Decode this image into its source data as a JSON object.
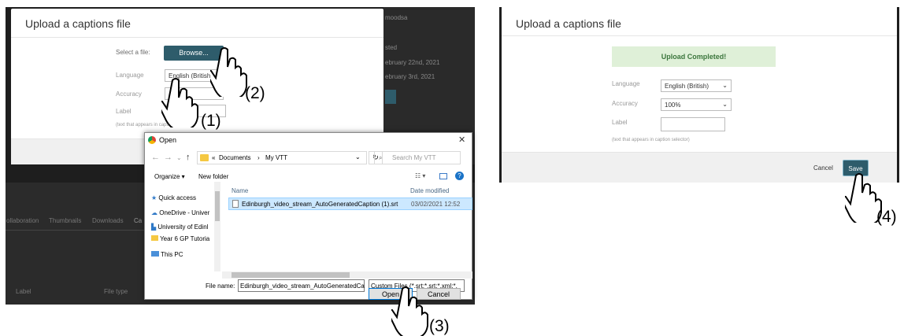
{
  "left_dialog": {
    "title": "Upload a captions file",
    "select_file_label": "Select a file:",
    "browse_button": "Browse...",
    "language_label": "Language",
    "language_value": "English (British)",
    "accuracy_label": "Accuracy",
    "label_label": "Label",
    "label_hint": "(text that appears in caption selector)"
  },
  "background_page": {
    "side_text_1": "moodsa",
    "side_text_2": "sted",
    "side_text_3": "ebruary 22nd, 2021",
    "side_text_4": "ebruary 3rd, 2021",
    "tabs": [
      "ollaboration",
      "Thumbnails",
      "Downloads",
      "Ca"
    ],
    "col_label": "Label",
    "col_filetype": "File type"
  },
  "open_dialog": {
    "title": "Open",
    "breadcrumb_prefix": "«",
    "breadcrumb_1": "Documents",
    "breadcrumb_sep": "›",
    "breadcrumb_2": "My VTT",
    "search_placeholder": "Search My VTT",
    "organize": "Organize ▾",
    "new_folder": "New folder",
    "nav_items": [
      "Quick access",
      "OneDrive - Univer",
      "University of Edinl",
      "Year 6 GP Tutoria",
      "This PC"
    ],
    "col_name": "Name",
    "col_date": "Date modified",
    "file_name": "Edinburgh_video_stream_AutoGeneratedCaption (1).srt",
    "file_date": "03/02/2021 12:52",
    "file_name_label": "File name:",
    "file_name_value": "Edinburgh_video_stream_AutoGeneratedCa",
    "filter_value": "Custom Files (*.srt;*.srt;*.xml;*.",
    "open_button": "Open",
    "cancel_button": "Cancel"
  },
  "right_dialog": {
    "title": "Upload a captions file",
    "upload_status": "Upload Completed!",
    "language_label": "Language",
    "language_value": "English (British)",
    "accuracy_label": "Accuracy",
    "accuracy_value": "100%",
    "label_label": "Label",
    "label_hint": "(text that appears in caption selector)",
    "cancel_button": "Cancel",
    "save_button": "Save"
  },
  "steps": [
    "(1)",
    "(2)",
    "(3)",
    "(4)"
  ],
  "colors": {
    "accent": "#2e5c6b",
    "success_bg": "#dff0d8",
    "success_text": "#3c763d",
    "dark_bg": "#1e1e1e"
  }
}
